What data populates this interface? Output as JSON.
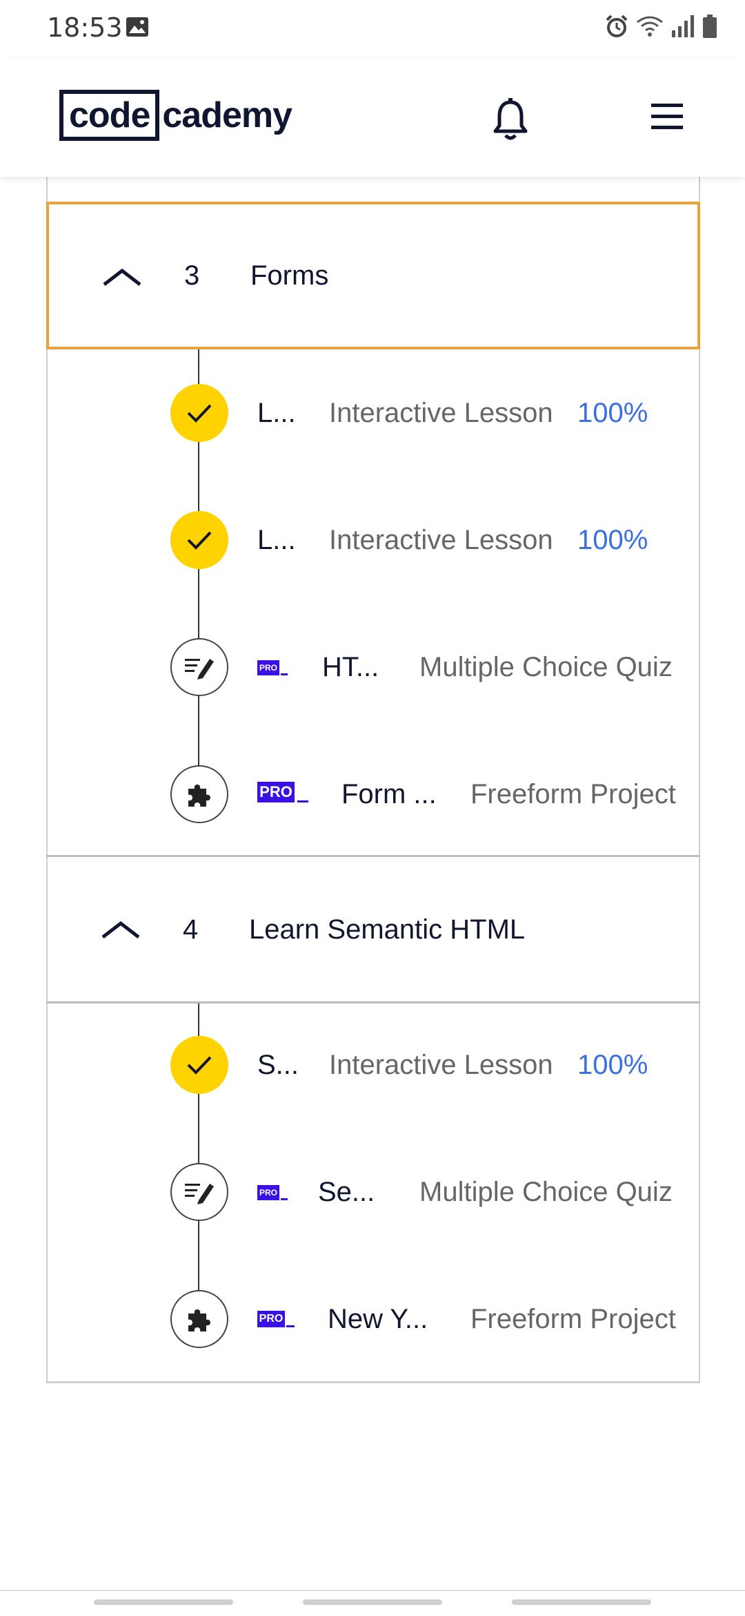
{
  "status": {
    "time": "18:53"
  },
  "header": {
    "logo_boxed": "code",
    "logo_rest": "cademy"
  },
  "modules": [
    {
      "number": "3",
      "title": "Forms",
      "items": [
        {
          "title": "L...",
          "type": "Interactive Lesson",
          "progress": "100%",
          "status": "complete",
          "icon": "check-icon",
          "pro": false
        },
        {
          "title": "L...",
          "type": "Interactive Lesson",
          "progress": "100%",
          "status": "complete",
          "icon": "check-icon",
          "pro": false
        },
        {
          "title": "HT...",
          "type": "Multiple Choice Quiz",
          "progress": "",
          "status": "locked",
          "icon": "quiz-pencil-icon",
          "pro": true,
          "pro_label": "PRO"
        },
        {
          "title": "Form ...",
          "type": "Freeform Project",
          "progress": "",
          "status": "locked",
          "icon": "puzzle-icon",
          "pro": true,
          "pro_label": "PRO"
        }
      ]
    },
    {
      "number": "4",
      "title": "Learn Semantic HTML",
      "items": [
        {
          "title": "S...",
          "type": "Interactive Lesson",
          "progress": "100%",
          "status": "complete",
          "icon": "check-icon",
          "pro": false
        },
        {
          "title": "Se...",
          "type": "Multiple Choice Quiz",
          "progress": "",
          "status": "locked",
          "icon": "quiz-pencil-icon",
          "pro": true,
          "pro_label": "PRO"
        },
        {
          "title": "New Y...",
          "type": "Freeform Project",
          "progress": "",
          "status": "locked",
          "icon": "puzzle-icon",
          "pro": true,
          "pro_label": "PRO"
        }
      ]
    }
  ],
  "colors": {
    "active_border": "#e6a23c",
    "complete": "#ffd300",
    "pro": "#3a10e5",
    "progress": "#3a6fe0",
    "brand": "#10162f"
  }
}
